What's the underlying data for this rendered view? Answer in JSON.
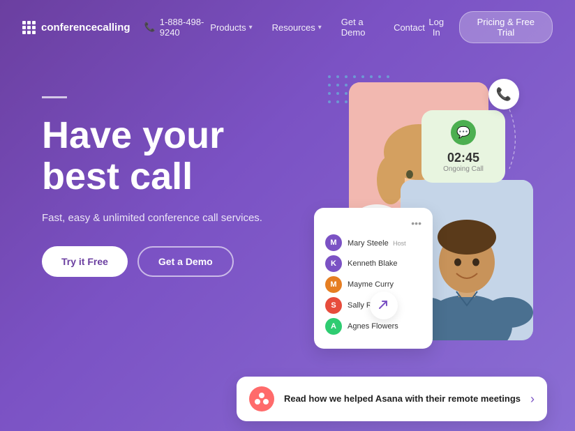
{
  "brand": {
    "name": "conferencecalling",
    "phone": "1-888-498-9240"
  },
  "nav": {
    "products_label": "Products",
    "resources_label": "Resources",
    "demo_label": "Get a Demo",
    "contact_label": "Contact",
    "login_label": "Log In",
    "pricing_label": "Pricing & Free Trial"
  },
  "hero": {
    "title_line1": "Have your",
    "title_line2": "best call",
    "subtitle": "Fast, easy & unlimited conference call services.",
    "btn_primary": "Try it Free",
    "btn_secondary": "Get a Demo"
  },
  "call_card": {
    "time": "02:45",
    "status": "Ongoing Call"
  },
  "participants": {
    "host_name": "Mary Steele",
    "host_label": "Host",
    "participants": [
      {
        "name": "Kenneth Blake",
        "color": "#7B52C4",
        "initials": "K"
      },
      {
        "name": "Mayme Curry",
        "color": "#E67E22",
        "initials": "M"
      },
      {
        "name": "Sally Riley",
        "color": "#E74C3C",
        "initials": "S"
      },
      {
        "name": "Agnes Flowers",
        "color": "#2ECC71",
        "initials": "A"
      }
    ]
  },
  "bottom_card": {
    "text": "Read how we helped Asana with their remote meetings"
  }
}
